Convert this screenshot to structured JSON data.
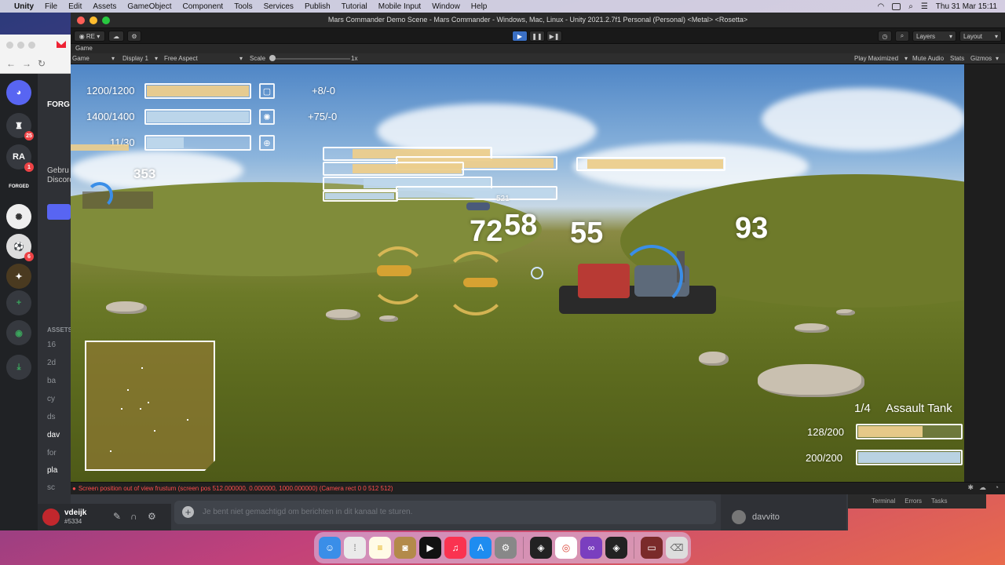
{
  "menubar": {
    "app": "Unity",
    "items": [
      "File",
      "Edit",
      "Assets",
      "GameObject",
      "Component",
      "Tools",
      "Services",
      "Publish",
      "Tutorial",
      "Mobile Input",
      "Window",
      "Help"
    ],
    "clock": "Thu 31 Mar  15:11"
  },
  "discord": {
    "servers": [
      {
        "label": "",
        "badge": "25"
      },
      {
        "label": "RA",
        "badge": "1"
      },
      {
        "label": "FORGED",
        "badge": ""
      },
      {
        "label": "",
        "badge": ""
      },
      {
        "label": "",
        "badge": "6"
      },
      {
        "label": "",
        "badge": ""
      }
    ],
    "channel_partial": {
      "server_name": "FORG",
      "welcome_1": "Gebru",
      "welcome_2": "Discord",
      "category": "ASSETS"
    },
    "channels": [
      "16",
      "2d",
      "ba",
      "cy",
      "ds",
      "dav",
      "for",
      "pla",
      "sc"
    ],
    "user": {
      "name": "vdeijk",
      "tag": "#5334"
    },
    "message_placeholder": "Je bent niet gemachtigd om berichten in dit kanaal te sturen.",
    "members": [
      "davvito"
    ]
  },
  "unity": {
    "title": "Mars Commander Demo Scene - Mars Commander - Windows, Mac, Linux - Unity 2021.2.7f1 Personal (Personal) <Metal> <Rosetta>",
    "account_btn": "RE",
    "layers_label": "Layers",
    "layout_label": "Layout",
    "tab_label": "Game",
    "gamebar": {
      "mode": "Game",
      "display": "Display 1",
      "aspect": "Free Aspect",
      "scale_label": "Scale",
      "scale_value": "1x",
      "play_maximized": "Play Maximized",
      "mute": "Mute Audio",
      "stats": "Stats",
      "gizmos": "Gizmos"
    },
    "console_error": "Screen position out of view frustum (screen pos 512.000000, 0.000000, 1000.000000) (Camera rect 0 0 512 512)",
    "console_tabs": [
      "Terminal",
      "Errors",
      "Tasks"
    ]
  },
  "hud": {
    "top_left": [
      {
        "label": "1200/1200",
        "fill": 1.0,
        "style": "gold",
        "delta": "+8/-0"
      },
      {
        "label": "1400/1400",
        "fill": 1.0,
        "style": "blue",
        "delta": "+75/-0"
      },
      {
        "label": "11/30",
        "fill": 0.37,
        "style": "blue",
        "delta": ""
      }
    ],
    "floating_numbers": [
      "353",
      "72",
      "58",
      "55",
      "93",
      "521"
    ],
    "unit": {
      "count": "1/4",
      "name": "Assault Tank",
      "hp_label": "128/200",
      "hp_fill": 0.64,
      "shield_label": "200/200",
      "shield_fill": 1.0
    }
  },
  "colors": {
    "hud_gold": "#ecce8c",
    "hud_blue": "#bed7eb",
    "unity_play": "#3a6fc4",
    "error": "#ff4d4d"
  }
}
